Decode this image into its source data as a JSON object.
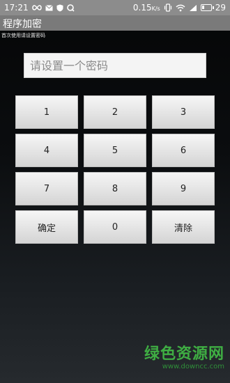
{
  "status_bar": {
    "time": "17:21",
    "speed": "0.15",
    "speed_unit": "K/s",
    "battery": "29",
    "battery_level": 0.29,
    "icons": [
      "infinity-icon",
      "mail-icon",
      "shield-icon",
      "q-icon",
      "vibrate-icon",
      "wifi-icon",
      "signal-icon"
    ]
  },
  "app": {
    "title": "程序加密",
    "hint": "首次使用请设置密码"
  },
  "password": {
    "placeholder": "请设置一个密码",
    "value": ""
  },
  "keypad": {
    "keys": [
      "1",
      "2",
      "3",
      "4",
      "5",
      "6",
      "7",
      "8",
      "9",
      "确定",
      "0",
      "清除"
    ]
  },
  "watermark": {
    "title": "绿色资源网",
    "url": "www.downcc.com"
  }
}
